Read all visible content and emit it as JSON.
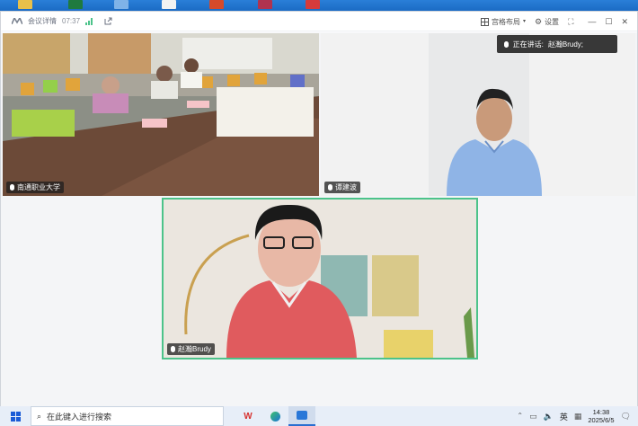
{
  "window": {
    "title": "会议详情",
    "elapsed": "07:37",
    "layout_label": "宫格布局",
    "settings_label": "设置"
  },
  "speaking": {
    "prefix": "正在讲话:",
    "name": "赵瀚Brudy;"
  },
  "participants": [
    {
      "name": "南通职业大学"
    },
    {
      "name": "谭建波"
    },
    {
      "name": "赵瀚Brudy"
    }
  ],
  "taskbar": {
    "search_placeholder": "在此键入进行搜索",
    "ime": "英",
    "time": "14:38",
    "date": "2025/6/5"
  },
  "colors": {
    "active_speaker_border": "#4cc38a",
    "taskbar_bg": "#e7eef8",
    "desktop": "#1a6fd0"
  }
}
